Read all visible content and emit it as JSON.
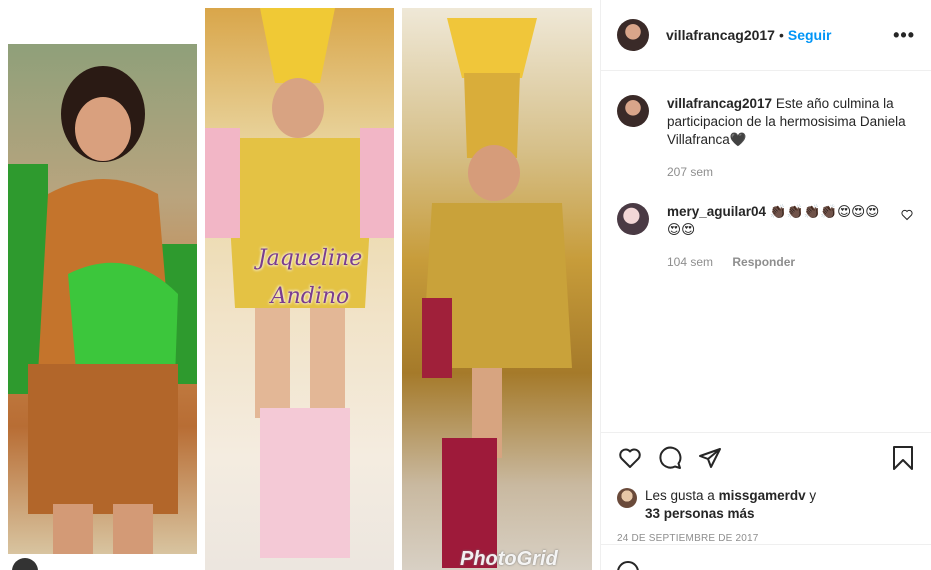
{
  "post": {
    "photo_alt": "Tres fotos de Daniela Villafranca con trajes de palillona",
    "overlay_line1": "Jaqueline",
    "overlay_line2": "Andino",
    "watermark": "PhotoGrid"
  },
  "header": {
    "username": "villafrancag2017",
    "separator": "•",
    "follow_label": "Seguir",
    "more_label": "•••"
  },
  "caption": {
    "username": "villafrancag2017",
    "text": "Este año culmina la participacion de la hermosisima Daniela Villafranca🖤",
    "age": "207 sem"
  },
  "comments": [
    {
      "username": "mery_aguilar04",
      "text": "👏🏿👏🏿👏🏿👏🏿😍😍😍😍😍",
      "age": "104 sem",
      "reply_label": "Responder"
    }
  ],
  "likes": {
    "prefix": "Les gusta a",
    "user": "missgamerdv",
    "connector": "y",
    "others": "33 personas más"
  },
  "date": "24 DE SEPTIEMBRE DE 2017",
  "icons": {
    "like": "heart-icon",
    "comment": "comment-icon",
    "share": "share-icon",
    "save": "bookmark-icon",
    "emoji": "emoji-icon"
  }
}
